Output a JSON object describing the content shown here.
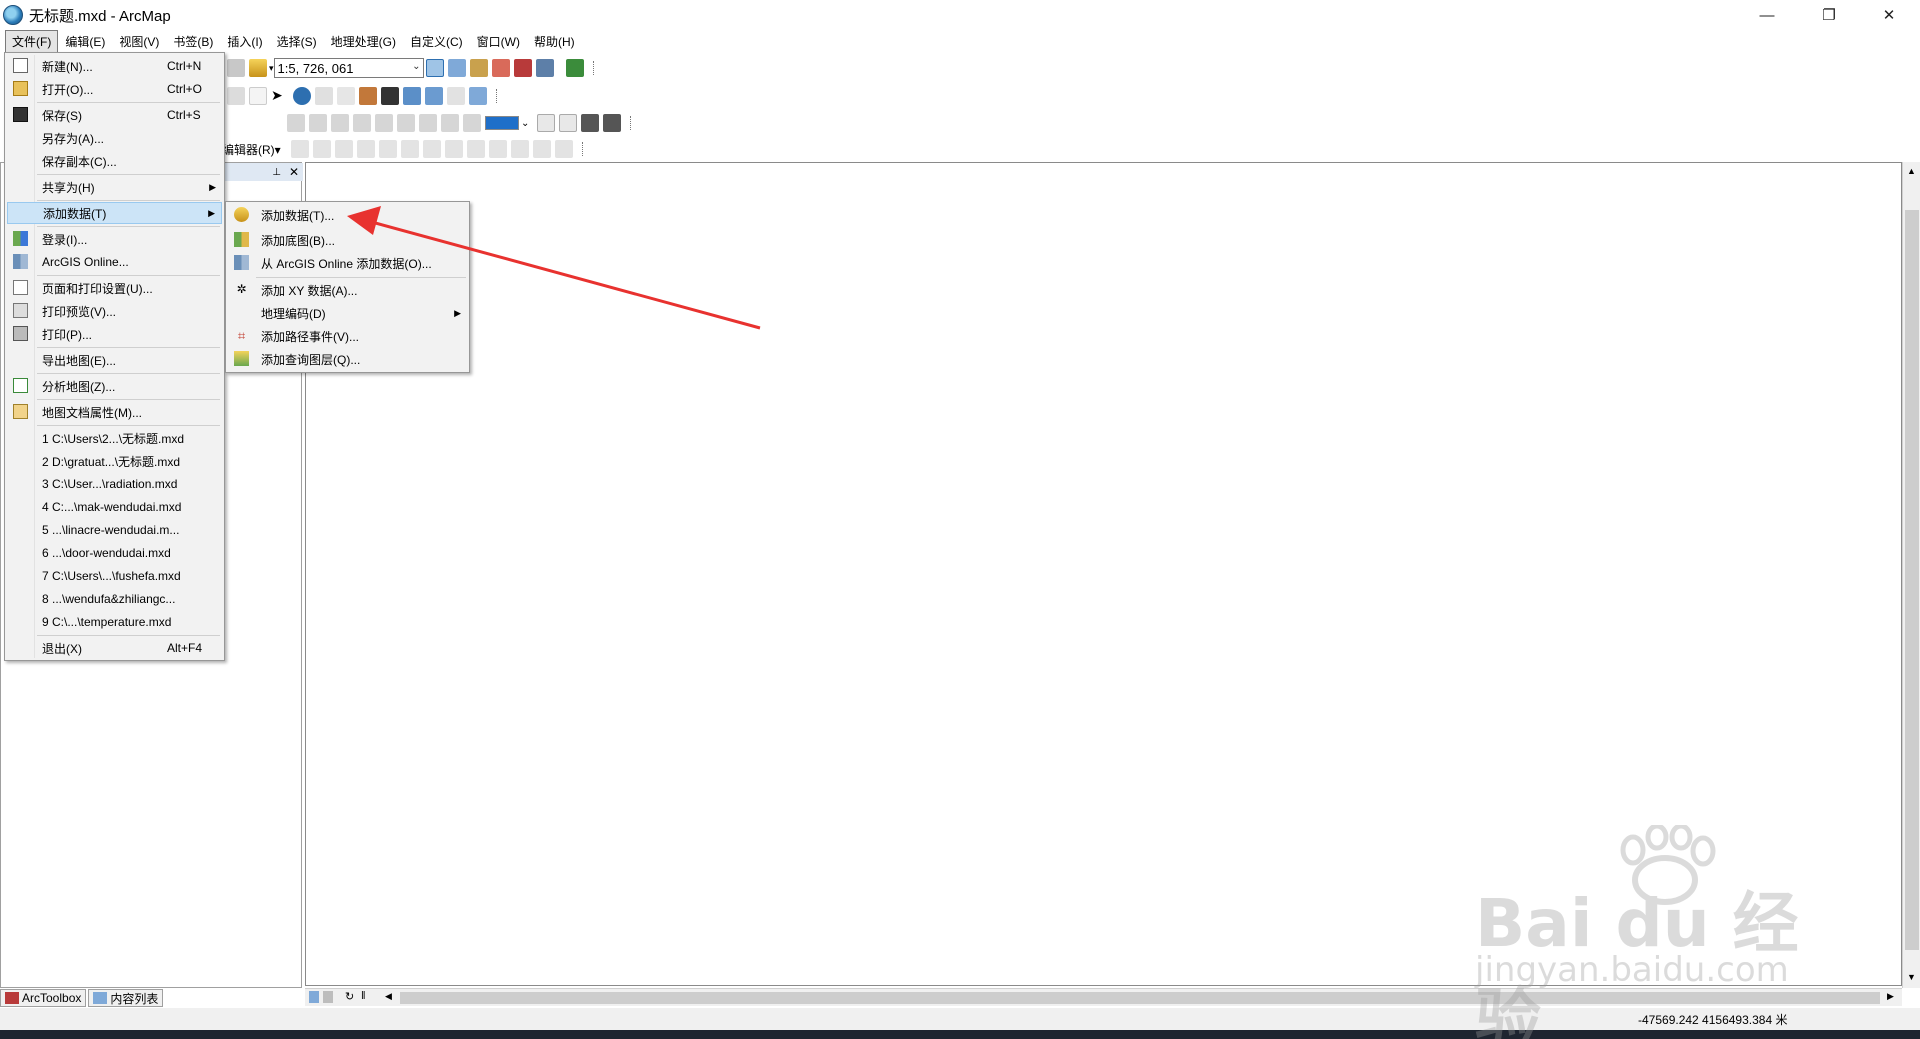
{
  "window": {
    "title": "无标题.mxd - ArcMap",
    "minimize_glyph": "—",
    "restore_glyph": "❐",
    "close_glyph": "✕"
  },
  "menubar": {
    "items": [
      "文件(F)",
      "编辑(E)",
      "视图(V)",
      "书签(B)",
      "插入(I)",
      "选择(S)",
      "地理处理(G)",
      "自定义(C)",
      "窗口(W)",
      "帮助(H)"
    ]
  },
  "toolbar": {
    "scale_value": "1:5, 726, 061",
    "editor_label": "编辑器(R)▾"
  },
  "file_menu": {
    "items": [
      {
        "label": "新建(N)...",
        "shortcut": "Ctrl+N",
        "icon": "new-document-icon"
      },
      {
        "label": "打开(O)...",
        "shortcut": "Ctrl+O",
        "icon": "open-folder-icon"
      },
      {
        "label": "保存(S)",
        "shortcut": "Ctrl+S",
        "icon": "save-icon"
      },
      {
        "label": "另存为(A)...",
        "shortcut": "",
        "icon": ""
      },
      {
        "label": "保存副本(C)...",
        "shortcut": "",
        "icon": ""
      },
      {
        "label": "共享为(H)",
        "shortcut": "",
        "icon": "",
        "submenu": true
      },
      {
        "label": "添加数据(T)",
        "shortcut": "",
        "icon": "",
        "submenu": true,
        "highlighted": true
      },
      {
        "label": "登录(I)...",
        "shortcut": "",
        "icon": "grid-icon"
      },
      {
        "label": "ArcGIS Online...",
        "shortcut": "",
        "icon": "grid-icon"
      },
      {
        "label": "页面和打印设置(U)...",
        "shortcut": "",
        "icon": "page-setup-icon"
      },
      {
        "label": "打印预览(V)...",
        "shortcut": "",
        "icon": "print-preview-icon"
      },
      {
        "label": "打印(P)...",
        "shortcut": "",
        "icon": "printer-icon"
      },
      {
        "label": "导出地图(E)...",
        "shortcut": "",
        "icon": ""
      },
      {
        "label": "分析地图(Z)...",
        "shortcut": "",
        "icon": "analyze-icon"
      },
      {
        "label": "地图文档属性(M)...",
        "shortcut": "",
        "icon": "properties-icon"
      },
      {
        "label": "1 C:\\Users\\2...\\无标题.mxd",
        "shortcut": "",
        "icon": ""
      },
      {
        "label": "2 D:\\gratuat...\\无标题.mxd",
        "shortcut": "",
        "icon": ""
      },
      {
        "label": "3 C:\\User...\\radiation.mxd",
        "shortcut": "",
        "icon": ""
      },
      {
        "label": "4 C:...\\mak-wendudai.mxd",
        "shortcut": "",
        "icon": ""
      },
      {
        "label": "5 ...\\linacre-wendudai.m...",
        "shortcut": "",
        "icon": ""
      },
      {
        "label": "6 ...\\door-wendudai.mxd",
        "shortcut": "",
        "icon": ""
      },
      {
        "label": "7 C:\\Users\\...\\fushefa.mxd",
        "shortcut": "",
        "icon": ""
      },
      {
        "label": "8 ...\\wendufa&zhiliangc...",
        "shortcut": "",
        "icon": ""
      },
      {
        "label": "9 C:\\...\\temperature.mxd",
        "shortcut": "",
        "icon": ""
      },
      {
        "label": "退出(X)",
        "shortcut": "Alt+F4",
        "icon": ""
      }
    ]
  },
  "add_data_submenu": {
    "items": [
      {
        "label": "添加数据(T)...",
        "icon": "add-data-icon"
      },
      {
        "label": "添加底图(B)...",
        "icon": "basemap-icon"
      },
      {
        "label": "从 ArcGIS Online 添加数据(O)...",
        "icon": "grid-icon"
      },
      {
        "label": "添加 XY 数据(A)...",
        "icon": "xy-data-icon"
      },
      {
        "label": "地理编码(D)",
        "icon": "",
        "submenu": true
      },
      {
        "label": "添加路径事件(V)...",
        "icon": "route-events-icon"
      },
      {
        "label": "添加查询图层(Q)...",
        "icon": "query-layer-icon"
      }
    ]
  },
  "toc": {
    "pin_glyph": "📌",
    "close_glyph": "✕",
    "tabs": [
      "ArcToolbox",
      "内容列表"
    ]
  },
  "statusbar": {
    "coordinates": "-47569.242  4156493.384 米"
  },
  "watermark": {
    "line1": "Bai du 经验",
    "line2": "jingyan.baidu.com"
  },
  "colors": {
    "menu_highlight": "#cce4f7",
    "arrow": "#e8322f"
  }
}
